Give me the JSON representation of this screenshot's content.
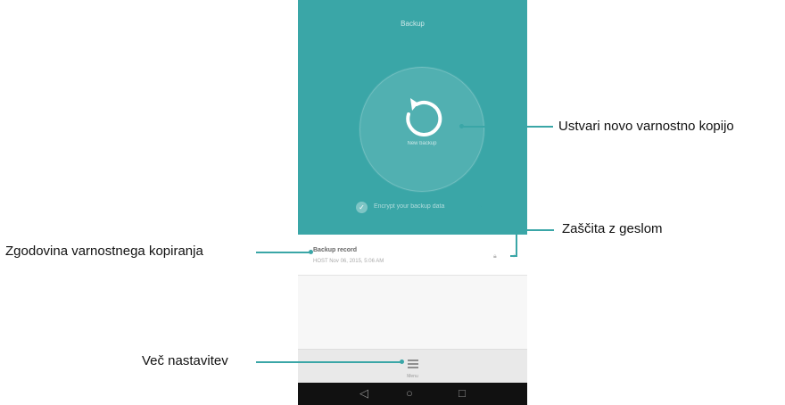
{
  "app": {
    "title": "Backup",
    "backup_button_label": "New backup",
    "encrypt_label": "Encrypt your backup data",
    "record_title": "Backup record",
    "record_date": "HOST Nov 06, 2015, 5:06 AM",
    "menu_label": "Menu"
  },
  "navigation": {
    "back_glyph": "◁",
    "home_glyph": "○",
    "recent_glyph": "□"
  },
  "callouts": {
    "new_backup": "Ustvari novo varnostno kopijo",
    "password": "Zaščita z geslom",
    "history": "Zgodovina varnostnega kopiranja",
    "more_settings": "Več nastavitev"
  },
  "colors": {
    "accent": "#3aa6a7",
    "callout_line": "#3aa6a7",
    "navbar": "#111111"
  },
  "icons": [
    "refresh-icon",
    "check-icon",
    "lock-icon",
    "chevron-right-icon",
    "menu-icon",
    "back-icon",
    "home-icon",
    "recent-apps-icon"
  ]
}
